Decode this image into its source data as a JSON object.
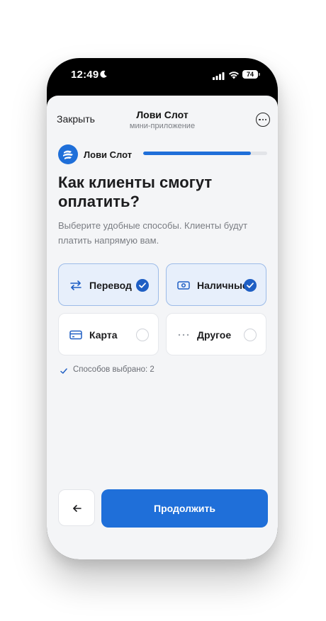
{
  "status_bar": {
    "time": "12:49",
    "battery": "74"
  },
  "nav": {
    "close_label": "Закрыть",
    "title": "Лови Слот",
    "subtitle": "мини-приложение"
  },
  "brand": {
    "name": "Лови Слот",
    "progress_fraction": 0.87
  },
  "content": {
    "heading": "Как клиенты смогут оплатить?",
    "description": "Выберите удобные способы. Клиенты будут платить напрямую вам."
  },
  "options": [
    {
      "label": "Перевод",
      "icon": "transfer-arrows-icon",
      "selected": true
    },
    {
      "label": "Наличные",
      "icon": "cash-icon",
      "selected": true
    },
    {
      "label": "Карта",
      "icon": "card-icon",
      "selected": false
    },
    {
      "label": "Другое",
      "icon": "more-dots-icon",
      "selected": false
    }
  ],
  "selection_summary": "Способов выбрано: 2",
  "footer": {
    "continue_label": "Продолжить"
  },
  "colors": {
    "accent": "#1f6fd9",
    "selected_bg": "#e7effb",
    "selected_border": "#9cbbe8",
    "sheet_bg": "#f4f5f7"
  }
}
